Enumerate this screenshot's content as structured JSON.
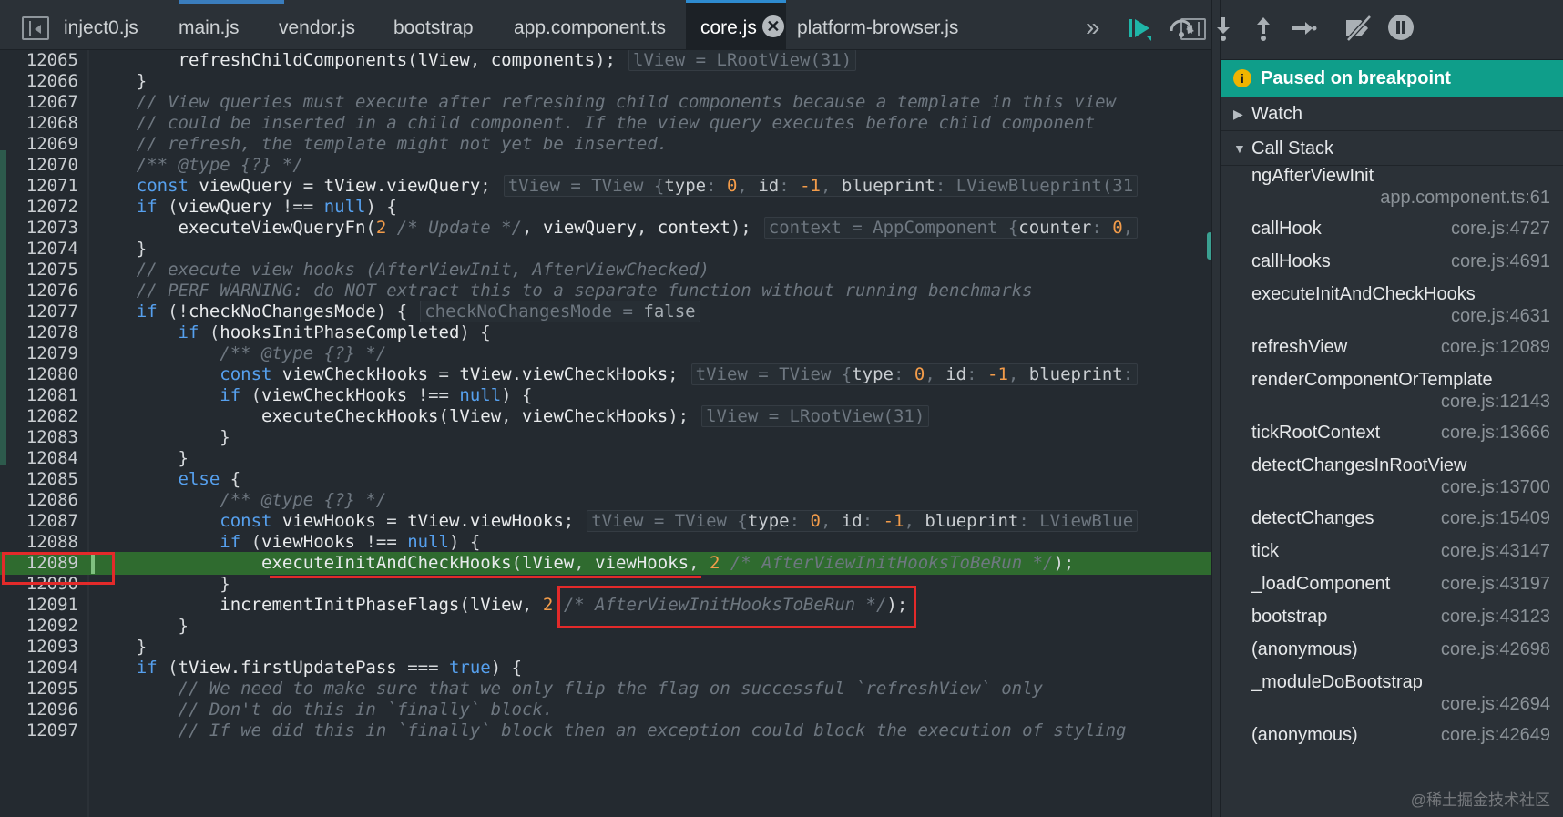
{
  "tabs": [
    {
      "label": "inject0.js"
    },
    {
      "label": "main.js"
    },
    {
      "label": "vendor.js"
    },
    {
      "label": "bootstrap"
    },
    {
      "label": "app.component.ts"
    },
    {
      "label": "core.js",
      "active": true,
      "close": "✕"
    },
    {
      "label": "platform-browser.js"
    }
  ],
  "tab_more": "»",
  "debugger": {
    "paused_label": "Paused on breakpoint",
    "paused_icon": "i",
    "watch_label": "Watch",
    "callstack_label": "Call Stack",
    "frames": [
      {
        "fn": "ngAfterViewInit",
        "loc": "app.component.ts:61",
        "wrap": true
      },
      {
        "fn": "callHook",
        "loc": "core.js:4727"
      },
      {
        "fn": "callHooks",
        "loc": "core.js:4691"
      },
      {
        "fn": "executeInitAndCheckHooks",
        "loc": "core.js:4631",
        "wrap": true
      },
      {
        "fn": "refreshView",
        "loc": "core.js:12089"
      },
      {
        "fn": "renderComponentOrTemplate",
        "loc": "core.js:12143",
        "wrap": true
      },
      {
        "fn": "tickRootContext",
        "loc": "core.js:13666"
      },
      {
        "fn": "detectChangesInRootView",
        "loc": "core.js:13700",
        "wrap": true
      },
      {
        "fn": "detectChanges",
        "loc": "core.js:15409"
      },
      {
        "fn": "tick",
        "loc": "core.js:43147"
      },
      {
        "fn": "_loadComponent",
        "loc": "core.js:43197"
      },
      {
        "fn": "bootstrap",
        "loc": "core.js:43123"
      },
      {
        "fn": "(anonymous)",
        "loc": "core.js:42698"
      },
      {
        "fn": "_moduleDoBootstrap",
        "loc": "core.js:42694",
        "wrap": true
      },
      {
        "fn": "(anonymous)",
        "loc": "core.js:42649"
      }
    ],
    "watermark": "@稀土掘金技术社区"
  },
  "code_lines": [
    {
      "n": "12065",
      "t": [
        [
          "id",
          "        refreshChildComponents"
        ],
        [
          "p",
          "("
        ],
        [
          "id",
          "lView"
        ],
        [
          "p",
          ", "
        ],
        [
          "id",
          "components"
        ],
        [
          "p",
          ");"
        ]
      ],
      "v": [
        [
          "c",
          "lView = LRootView(31)"
        ]
      ]
    },
    {
      "n": "12066",
      "t": [
        [
          "p",
          "    }"
        ]
      ]
    },
    {
      "n": "12067",
      "t": [
        [
          "cm",
          "    // View queries must execute after refreshing child components because a template in this view"
        ]
      ]
    },
    {
      "n": "12068",
      "t": [
        [
          "cm",
          "    // could be inserted in a child component. If the view query executes before child component"
        ]
      ]
    },
    {
      "n": "12069",
      "t": [
        [
          "cm",
          "    // refresh, the template might not yet be inserted."
        ]
      ]
    },
    {
      "n": "12070",
      "t": [
        [
          "cm",
          "    /** @type {?} */"
        ]
      ]
    },
    {
      "n": "12071",
      "t": [
        [
          "kw",
          "    const "
        ],
        [
          "id",
          "viewQuery"
        ],
        [
          "p",
          " = "
        ],
        [
          "id",
          "tView.viewQuery"
        ],
        [
          "p",
          ";"
        ]
      ],
      "v": [
        [
          "c",
          "tView = TView {"
        ],
        [
          "k",
          "type"
        ],
        [
          "c",
          ": "
        ],
        [
          "n",
          "0"
        ],
        [
          "c",
          ", "
        ],
        [
          "k",
          "id"
        ],
        [
          "c",
          ": "
        ],
        [
          "n",
          "-1"
        ],
        [
          "c",
          ", "
        ],
        [
          "k",
          "blueprint"
        ],
        [
          "c",
          ": LViewBlueprint(31"
        ]
      ]
    },
    {
      "n": "12072",
      "t": [
        [
          "kw",
          "    if "
        ],
        [
          "p",
          "("
        ],
        [
          "id",
          "viewQuery"
        ],
        [
          "p",
          " !== "
        ],
        [
          "kw",
          "null"
        ],
        [
          "p",
          ") {"
        ]
      ]
    },
    {
      "n": "12073",
      "t": [
        [
          "id",
          "        executeViewQueryFn"
        ],
        [
          "p",
          "("
        ],
        [
          "num",
          "2"
        ],
        [
          "cm",
          " /* Update */"
        ],
        [
          "p",
          ", "
        ],
        [
          "id",
          "viewQuery"
        ],
        [
          "p",
          ", "
        ],
        [
          "id",
          "context"
        ],
        [
          "p",
          ");"
        ]
      ],
      "v": [
        [
          "c",
          "context = AppComponent {"
        ],
        [
          "k",
          "counter"
        ],
        [
          "c",
          ": "
        ],
        [
          "n",
          "0"
        ],
        [
          "c",
          ","
        ]
      ]
    },
    {
      "n": "12074",
      "t": [
        [
          "p",
          "    }"
        ]
      ]
    },
    {
      "n": "12075",
      "t": [
        [
          "cm",
          "    // execute view hooks (AfterViewInit, AfterViewChecked)"
        ]
      ]
    },
    {
      "n": "12076",
      "t": [
        [
          "cm",
          "    // PERF WARNING: do NOT extract this to a separate function without running benchmarks"
        ]
      ]
    },
    {
      "n": "12077",
      "t": [
        [
          "kw",
          "    if "
        ],
        [
          "p",
          "(!"
        ],
        [
          "id",
          "checkNoChangesMode"
        ],
        [
          "p",
          ") {"
        ]
      ],
      "v": [
        [
          "c",
          "checkNoChangesMode = "
        ],
        [
          "kw",
          "false"
        ]
      ]
    },
    {
      "n": "12078",
      "t": [
        [
          "kw",
          "        if "
        ],
        [
          "p",
          "("
        ],
        [
          "id",
          "hooksInitPhaseCompleted"
        ],
        [
          "p",
          ") {"
        ]
      ]
    },
    {
      "n": "12079",
      "t": [
        [
          "cm",
          "            /** @type {?} */"
        ]
      ]
    },
    {
      "n": "12080",
      "t": [
        [
          "kw",
          "            const "
        ],
        [
          "id",
          "viewCheckHooks"
        ],
        [
          "p",
          " = "
        ],
        [
          "id",
          "tView.viewCheckHooks"
        ],
        [
          "p",
          ";"
        ]
      ],
      "v": [
        [
          "c",
          "tView = TView {"
        ],
        [
          "k",
          "type"
        ],
        [
          "c",
          ": "
        ],
        [
          "n",
          "0"
        ],
        [
          "c",
          ", "
        ],
        [
          "k",
          "id"
        ],
        [
          "c",
          ": "
        ],
        [
          "n",
          "-1"
        ],
        [
          "c",
          ", "
        ],
        [
          "k",
          "blueprint"
        ],
        [
          "c",
          ":"
        ]
      ]
    },
    {
      "n": "12081",
      "t": [
        [
          "kw",
          "            if "
        ],
        [
          "p",
          "("
        ],
        [
          "id",
          "viewCheckHooks"
        ],
        [
          "p",
          " !== "
        ],
        [
          "kw",
          "null"
        ],
        [
          "p",
          ") {"
        ]
      ]
    },
    {
      "n": "12082",
      "t": [
        [
          "id",
          "                executeCheckHooks"
        ],
        [
          "p",
          "("
        ],
        [
          "id",
          "lView"
        ],
        [
          "p",
          ", "
        ],
        [
          "id",
          "viewCheckHooks"
        ],
        [
          "p",
          ");"
        ]
      ],
      "v": [
        [
          "c",
          "lView = LRootView(31)"
        ]
      ]
    },
    {
      "n": "12083",
      "t": [
        [
          "p",
          "            }"
        ]
      ]
    },
    {
      "n": "12084",
      "t": [
        [
          "p",
          "        }"
        ]
      ]
    },
    {
      "n": "12085",
      "t": [
        [
          "kw",
          "        else "
        ],
        [
          "p",
          "{"
        ]
      ]
    },
    {
      "n": "12086",
      "t": [
        [
          "cm",
          "            /** @type {?} */"
        ]
      ]
    },
    {
      "n": "12087",
      "t": [
        [
          "kw",
          "            const "
        ],
        [
          "id",
          "viewHooks"
        ],
        [
          "p",
          " = "
        ],
        [
          "id",
          "tView.viewHooks"
        ],
        [
          "p",
          ";"
        ]
      ],
      "v": [
        [
          "c",
          "tView = TView {"
        ],
        [
          "k",
          "type"
        ],
        [
          "c",
          ": "
        ],
        [
          "n",
          "0"
        ],
        [
          "c",
          ", "
        ],
        [
          "k",
          "id"
        ],
        [
          "c",
          ": "
        ],
        [
          "n",
          "-1"
        ],
        [
          "c",
          ", "
        ],
        [
          "k",
          "blueprint"
        ],
        [
          "c",
          ": LViewBlue"
        ]
      ]
    },
    {
      "n": "12088",
      "t": [
        [
          "kw",
          "            if "
        ],
        [
          "p",
          "("
        ],
        [
          "id",
          "viewHooks"
        ],
        [
          "p",
          " !== "
        ],
        [
          "kw",
          "null"
        ],
        [
          "p",
          ") {"
        ]
      ]
    },
    {
      "n": "12089",
      "hl": true,
      "t": [
        [
          "id",
          "                executeInitAndCheckHooks"
        ],
        [
          "p",
          "("
        ],
        [
          "id",
          "lView"
        ],
        [
          "p",
          ", "
        ],
        [
          "id",
          "viewHooks"
        ],
        [
          "p",
          ", "
        ],
        [
          "num",
          "2"
        ],
        [
          "cm",
          " /* AfterViewInitHooksToBeRun */"
        ],
        [
          "p",
          ");"
        ]
      ]
    },
    {
      "n": "12090",
      "t": [
        [
          "p",
          "            }"
        ]
      ]
    },
    {
      "n": "12091",
      "t": [
        [
          "id",
          "            incrementInitPhaseFlags"
        ],
        [
          "p",
          "("
        ],
        [
          "id",
          "lView"
        ],
        [
          "p",
          ", "
        ],
        [
          "num",
          "2"
        ],
        [
          "cm",
          " /* AfterViewInitHooksToBeRun */"
        ],
        [
          "p",
          ");"
        ]
      ]
    },
    {
      "n": "12092",
      "t": [
        [
          "p",
          "        }"
        ]
      ]
    },
    {
      "n": "12093",
      "t": [
        [
          "p",
          "    }"
        ]
      ]
    },
    {
      "n": "12094",
      "t": [
        [
          "kw",
          "    if "
        ],
        [
          "p",
          "("
        ],
        [
          "id",
          "tView.firstUpdatePass"
        ],
        [
          "p",
          " === "
        ],
        [
          "kw",
          "true"
        ],
        [
          "p",
          ") {"
        ]
      ]
    },
    {
      "n": "12095",
      "t": [
        [
          "cm",
          "        // We need to make sure that we only flip the flag on successful `refreshView` only"
        ]
      ]
    },
    {
      "n": "12096",
      "t": [
        [
          "cm",
          "        // Don't do this in `finally` block."
        ]
      ]
    },
    {
      "n": "12097",
      "t": [
        [
          "cm",
          "        // If we did this in `finally` block then an exception could block the execution of styling"
        ]
      ]
    }
  ]
}
